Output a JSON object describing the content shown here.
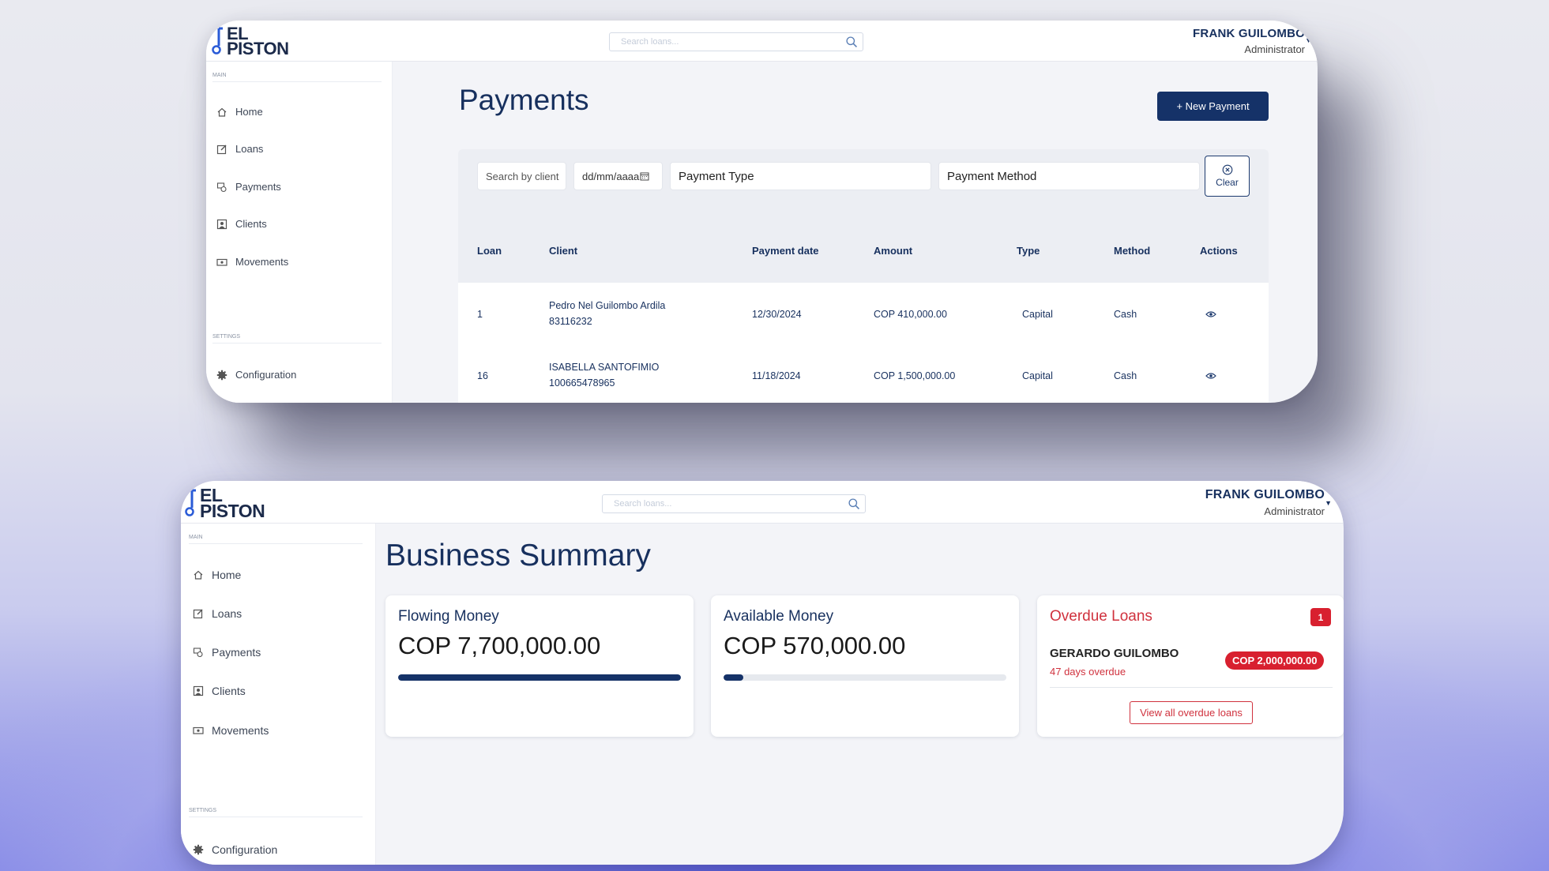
{
  "brand": {
    "logo_line1": "EL",
    "logo_line2": "PISTON"
  },
  "search": {
    "placeholder": "Search loans..."
  },
  "user": {
    "name": "FRANK GUILOMBO",
    "role": "Administrator"
  },
  "sidebar": {
    "main_section": "MAIN",
    "settings_section": "SETTINGS",
    "items": [
      {
        "label": "Home",
        "icon": "home-icon"
      },
      {
        "label": "Loans",
        "icon": "edit-icon"
      },
      {
        "label": "Payments",
        "icon": "payments-icon"
      },
      {
        "label": "Clients",
        "icon": "user-icon"
      },
      {
        "label": "Movements",
        "icon": "cash-icon"
      }
    ],
    "settings_items": [
      {
        "label": "Configuration",
        "icon": "gear-icon"
      }
    ]
  },
  "payments_page": {
    "title": "Payments",
    "new_button": "+ New Payment",
    "filters": {
      "client_placeholder": "Search by client",
      "date_placeholder": "dd/mm/aaaa",
      "payment_type": "Payment Type",
      "payment_method": "Payment Method",
      "clear": "Clear"
    },
    "columns": [
      "Loan",
      "Client",
      "Payment date",
      "Amount",
      "Type",
      "Method",
      "Actions"
    ],
    "rows": [
      {
        "loan": "1",
        "client_name": "Pedro Nel Guilombo Ardila",
        "client_id": "83116232",
        "date": "12/30/2024",
        "amount": "COP 410,000.00",
        "type": "Capital",
        "method": "Cash"
      },
      {
        "loan": "16",
        "client_name": "ISABELLA SANTOFIMIO",
        "client_id": "100665478965",
        "date": "11/18/2024",
        "amount": "COP 1,500,000.00",
        "type": "Capital",
        "method": "Cash"
      }
    ]
  },
  "summary_page": {
    "title": "Business Summary",
    "flowing": {
      "label": "Flowing Money",
      "amount": "COP 7,700,000.00",
      "progress": 1.0
    },
    "available": {
      "label": "Available Money",
      "amount": "COP 570,000.00",
      "progress": 0.07
    },
    "overdue": {
      "label": "Overdue Loans",
      "count": "1",
      "client": "GERARDO GUILOMBO",
      "days": "47 days overdue",
      "amount": "COP 2,000,000.00",
      "view_all": "View all overdue loans"
    }
  },
  "colors": {
    "primary": "#153268",
    "danger": "#d8202f",
    "background": "#f3f4f8"
  }
}
